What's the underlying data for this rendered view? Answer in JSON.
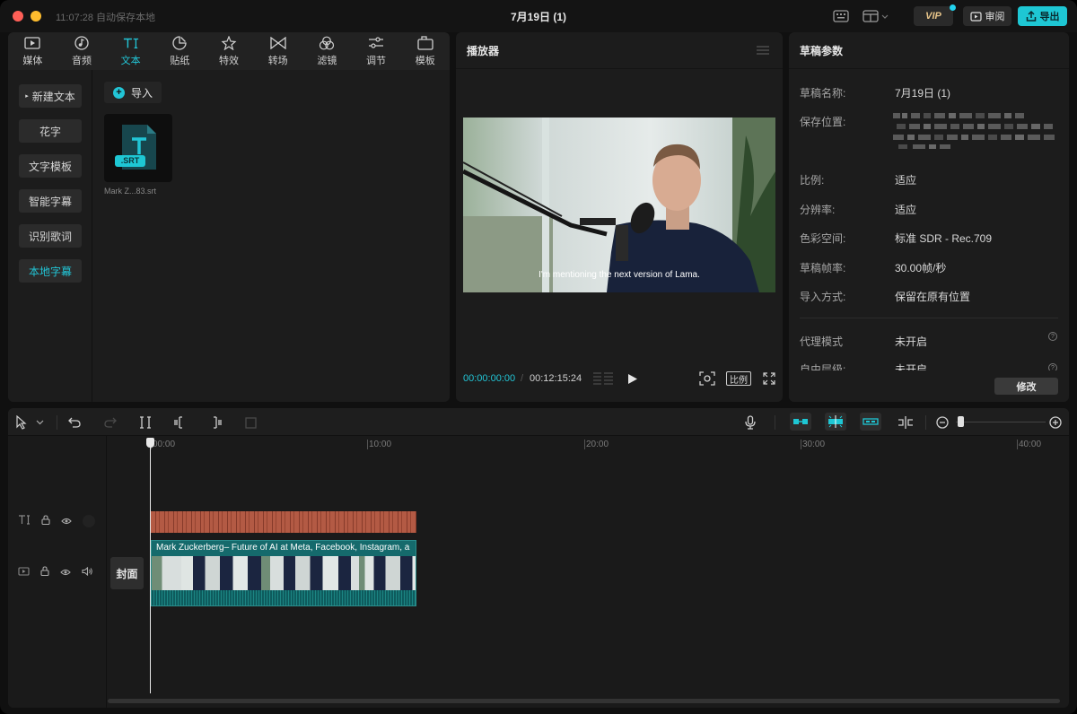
{
  "titlebar": {
    "autosave": "11:07:28 自动保存本地",
    "title": "7月19日 (1)",
    "vip_label": "VIP",
    "review_label": "审阅",
    "export_label": "导出"
  },
  "media": {
    "tabs": [
      {
        "label": "媒体",
        "icon": "media-icon"
      },
      {
        "label": "音频",
        "icon": "audio-icon"
      },
      {
        "label": "文本",
        "icon": "text-icon",
        "active": true
      },
      {
        "label": "贴纸",
        "icon": "sticker-icon"
      },
      {
        "label": "特效",
        "icon": "effects-icon"
      },
      {
        "label": "转场",
        "icon": "transition-icon"
      },
      {
        "label": "滤镜",
        "icon": "filter-icon"
      },
      {
        "label": "调节",
        "icon": "adjust-icon"
      },
      {
        "label": "模板",
        "icon": "template-icon"
      }
    ],
    "side_items": [
      "新建文本",
      "花字",
      "文字模板",
      "智能字幕",
      "识别歌词",
      "本地字幕"
    ],
    "active_side_item": "本地字幕",
    "import_label": "导入",
    "file_badge": ".SRT",
    "file_name": "Mark Z...83.srt"
  },
  "player": {
    "title": "播放器",
    "caption": "I'm mentioning the next version of Lama.",
    "current_time": "00:00:00:00",
    "separator": "/",
    "total_time": "00:12:15:24",
    "ratio_label": "比例"
  },
  "draft": {
    "title": "草稿参数",
    "rows": [
      {
        "label": "草稿名称:",
        "value": "7月19日 (1)"
      },
      {
        "label": "保存位置:",
        "value": ""
      },
      {
        "label": "比例:",
        "value": "适应"
      },
      {
        "label": "分辨率:",
        "value": "适应"
      },
      {
        "label": "色彩空间:",
        "value": "标准 SDR - Rec.709"
      },
      {
        "label": "草稿帧率:",
        "value": "30.00帧/秒"
      },
      {
        "label": "导入方式:",
        "value": "保留在原有位置"
      },
      {
        "label": "代理模式",
        "value": "未开启"
      },
      {
        "label": "自由层级:",
        "value": "未开启"
      }
    ],
    "modify_label": "修改"
  },
  "timeline": {
    "ruler": [
      "00:00",
      "10:00",
      "20:00",
      "30:00",
      "40:00"
    ],
    "cover_label": "封面",
    "video_clip_title": "Mark Zuckerberg– Future of AI at Meta, Facebook, Instagram, a"
  },
  "colors": {
    "accent": "#22c5d6",
    "export_button": "#1ec7d4",
    "subtitle_clip": "#b35a44",
    "video_clip": "#156a6c"
  }
}
